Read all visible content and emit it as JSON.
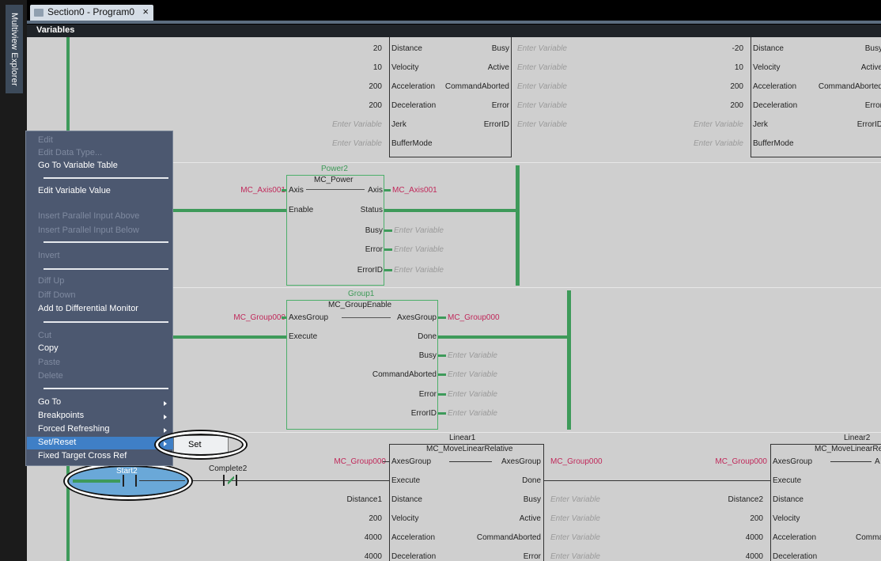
{
  "sidebar": {
    "label": "Multiview Explorer"
  },
  "tab": {
    "title": "Section0 - Program0",
    "close": "×"
  },
  "variables_bar": {
    "label": "Variables"
  },
  "placeholder": "Enter Variable",
  "rung1": {
    "left": {
      "inputs": [
        {
          "value": "20",
          "pin": "Distance"
        },
        {
          "value": "10",
          "pin": "Velocity"
        },
        {
          "value": "200",
          "pin": "Acceleration"
        },
        {
          "value": "200",
          "pin": "Deceleration"
        },
        {
          "value": "Enter Variable",
          "pin": "Jerk"
        },
        {
          "value": "Enter Variable",
          "pin": "BufferMode"
        }
      ],
      "outputs": [
        {
          "pin": "Busy",
          "value": "Enter Variable"
        },
        {
          "pin": "Active",
          "value": "Enter Variable"
        },
        {
          "pin": "CommandAborted",
          "value": "Enter Variable"
        },
        {
          "pin": "Error",
          "value": "Enter Variable"
        },
        {
          "pin": "ErrorID",
          "value": "Enter Variable"
        }
      ]
    },
    "right": {
      "inputs": [
        {
          "value": "-20",
          "pin": "Distance"
        },
        {
          "value": "10",
          "pin": "Velocity"
        },
        {
          "value": "200",
          "pin": "Acceleration"
        },
        {
          "value": "200",
          "pin": "Deceleration"
        },
        {
          "value": "Enter Variable",
          "pin": "Jerk"
        },
        {
          "value": "Enter Variable",
          "pin": "BufferMode"
        }
      ],
      "outputs": [
        "Busy",
        "Active",
        "CommandAborted",
        "Error",
        "ErrorID"
      ]
    }
  },
  "power": {
    "instance": "Power2",
    "fb": "MC_Power",
    "in_var": "MC_Axis001",
    "in_pin": "Axis",
    "in_pin2": "Enable",
    "out_pin": "Axis",
    "out_var": "MC_Axis001",
    "outputs": [
      "Status",
      "Busy",
      "Error",
      "ErrorID"
    ]
  },
  "group": {
    "instance": "Group1",
    "fb": "MC_GroupEnable",
    "in_var": "MC_Group000",
    "in_pin": "AxesGroup",
    "in_pin2": "Execute",
    "out_pin": "AxesGroup",
    "out_var": "MC_Group000",
    "outputs": [
      "Done",
      "Busy",
      "CommandAborted",
      "Error",
      "ErrorID"
    ]
  },
  "linear1": {
    "instance": "Linear1",
    "fb": "MC_MoveLinearRelative",
    "in_var": "MC_Group000",
    "in_pins": [
      "AxesGroup",
      "Execute",
      "Distance",
      "Velocity",
      "Acceleration",
      "Deceleration"
    ],
    "in_vals": [
      "Distance1",
      "200",
      "4000",
      "4000"
    ],
    "out_pins": [
      "AxesGroup",
      "Done",
      "Busy",
      "Active",
      "CommandAborted",
      "Error"
    ],
    "out_var": "MC_Group000"
  },
  "linear2": {
    "instance": "Linear2",
    "fb": "MC_MoveLinearRelat",
    "in_var": "MC_Group000",
    "in_pins": [
      "AxesGroup",
      "Execute",
      "Distance",
      "Velocity",
      "Acceleration",
      "Deceleration"
    ],
    "in_vals": [
      "Distance2",
      "200",
      "4000",
      "4000"
    ],
    "out_frag": "A",
    "out_frag2": "Comman"
  },
  "contacts": {
    "c1": "Start2",
    "c2": "Complete2"
  },
  "context_menu": {
    "items": [
      {
        "label": "Edit",
        "enabled": false
      },
      {
        "label": "Edit Data Type...",
        "enabled": false
      },
      {
        "label": "Go To Variable Table",
        "enabled": true
      },
      {
        "label": "Edit Variable Value",
        "enabled": true
      },
      {
        "label": "Insert Parallel Input Above",
        "enabled": false
      },
      {
        "label": "Insert Parallel Input Below",
        "enabled": false
      },
      {
        "label": "Invert",
        "enabled": false
      },
      {
        "label": "Diff Up",
        "enabled": false
      },
      {
        "label": "Diff Down",
        "enabled": false
      },
      {
        "label": "Add to Differential Monitor",
        "enabled": true
      },
      {
        "label": "Cut",
        "enabled": false
      },
      {
        "label": "Copy",
        "enabled": true
      },
      {
        "label": "Paste",
        "enabled": false
      },
      {
        "label": "Delete",
        "enabled": false
      },
      {
        "label": "Go To",
        "enabled": true
      },
      {
        "label": "Breakpoints",
        "enabled": true
      },
      {
        "label": "Forced Refreshing",
        "enabled": true
      },
      {
        "label": "Set/Reset",
        "enabled": true
      },
      {
        "label": "Fixed Target Cross Ref",
        "enabled": true
      }
    ]
  },
  "submenu": {
    "label": "Set"
  },
  "colors": {
    "rail": "#3e9a5a",
    "var": "#c0285a",
    "menu": "#4c5870",
    "selected": "#3f7fc6"
  }
}
